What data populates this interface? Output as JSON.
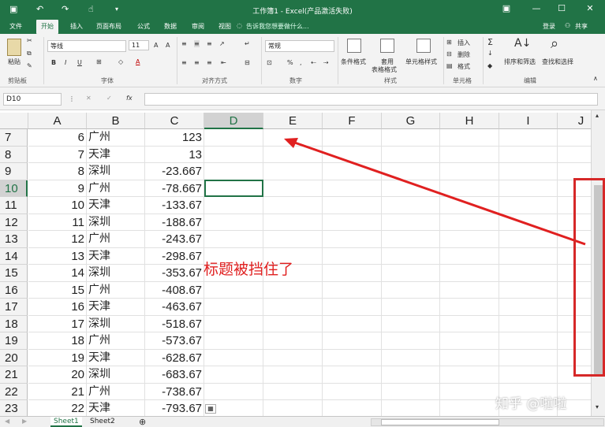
{
  "window": {
    "title": "工作簿1 - Excel(产品激活失败)",
    "quick_access": {
      "save_icon": "save-icon",
      "undo_icon": "undo-icon",
      "redo_icon": "redo-icon",
      "touch_icon": "touch-mode-icon",
      "customize_icon": "customize-icon"
    },
    "controls": {
      "ribbon_options": "▣",
      "minimize": "—",
      "maximize": "☐",
      "close": "✕"
    }
  },
  "tabs": {
    "items": [
      "文件",
      "开始",
      "插入",
      "页面布局",
      "公式",
      "数据",
      "审阅",
      "视图"
    ],
    "active": "开始",
    "tell_me": "告诉我您想要做什么...",
    "login": "登录",
    "share": "共享"
  },
  "ribbon": {
    "clipboard": {
      "label": "剪贴板",
      "paste": "粘贴"
    },
    "font": {
      "label": "字体",
      "name": "等线",
      "size": "11",
      "bold": "B",
      "italic": "I",
      "underline": "U"
    },
    "alignment": {
      "label": "对齐方式"
    },
    "number": {
      "label": "数字",
      "format": "常规",
      "percent": "%",
      "comma": ","
    },
    "styles": {
      "label": "样式",
      "conditional": "条件格式",
      "table_line1": "套用",
      "table_line2": "表格格式",
      "cell_styles": "单元格样式"
    },
    "cells": {
      "label": "单元格",
      "insert": "插入",
      "delete": "删除",
      "format": "格式"
    },
    "editing": {
      "label": "编辑",
      "sort": "排序和筛选",
      "find": "查找和选择"
    }
  },
  "formula_bar": {
    "name_box": "D10",
    "fx": "fx",
    "cancel": "✕",
    "enter": "✓",
    "value": ""
  },
  "sheet": {
    "columns": [
      "A",
      "B",
      "C",
      "D",
      "E",
      "F",
      "G",
      "H",
      "I",
      "J"
    ],
    "active_column": "D",
    "active_row": "10",
    "rows": [
      {
        "row": "7",
        "a": "6",
        "b": "广州",
        "c": "123"
      },
      {
        "row": "8",
        "a": "7",
        "b": "天津",
        "c": "13"
      },
      {
        "row": "9",
        "a": "8",
        "b": "深圳",
        "c": "-23.667"
      },
      {
        "row": "10",
        "a": "9",
        "b": "广州",
        "c": "-78.667"
      },
      {
        "row": "11",
        "a": "10",
        "b": "天津",
        "c": "-133.67"
      },
      {
        "row": "12",
        "a": "11",
        "b": "深圳",
        "c": "-188.67"
      },
      {
        "row": "13",
        "a": "12",
        "b": "广州",
        "c": "-243.67"
      },
      {
        "row": "14",
        "a": "13",
        "b": "天津",
        "c": "-298.67"
      },
      {
        "row": "15",
        "a": "14",
        "b": "深圳",
        "c": "-353.67"
      },
      {
        "row": "16",
        "a": "15",
        "b": "广州",
        "c": "-408.67"
      },
      {
        "row": "17",
        "a": "16",
        "b": "天津",
        "c": "-463.67"
      },
      {
        "row": "18",
        "a": "17",
        "b": "深圳",
        "c": "-518.67"
      },
      {
        "row": "19",
        "a": "18",
        "b": "广州",
        "c": "-573.67"
      },
      {
        "row": "20",
        "a": "19",
        "b": "天津",
        "c": "-628.67"
      },
      {
        "row": "21",
        "a": "20",
        "b": "深圳",
        "c": "-683.67"
      },
      {
        "row": "22",
        "a": "21",
        "b": "广州",
        "c": "-738.67"
      },
      {
        "row": "23",
        "a": "22",
        "b": "天津",
        "c": "-793.67"
      }
    ]
  },
  "annotation": {
    "text": "标题被挡住了",
    "color": "#e02020"
  },
  "sheet_tabs": {
    "items": [
      "Sheet1",
      "Sheet2"
    ],
    "active": "Sheet1",
    "add": "⊕"
  },
  "watermark": "知乎 @啦啦",
  "colors": {
    "accent": "#217346",
    "annotation": "#e02020"
  }
}
